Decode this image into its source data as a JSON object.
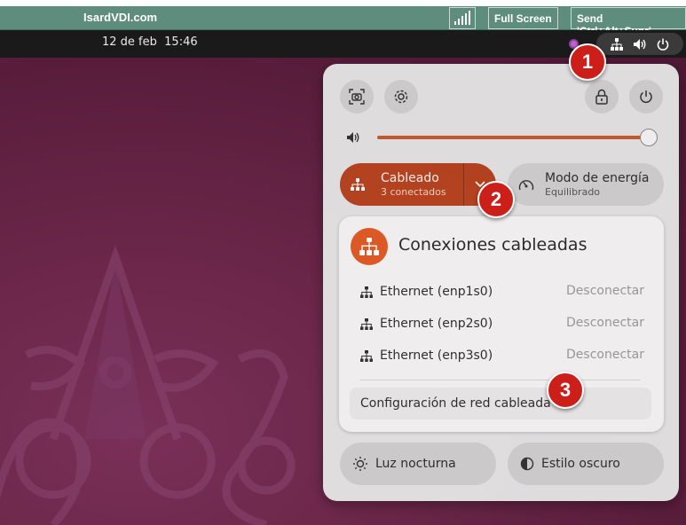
{
  "isard_bar": {
    "logo": "IsardVDI.com",
    "full_screen_label": "Full Screen",
    "send_keys_label": "Send 'Ctrl+Alt+Supr'"
  },
  "top_bar": {
    "date": "12 de feb",
    "time": "15:46"
  },
  "quick_settings": {
    "volume_level_percent": 100,
    "wired": {
      "title": "Cableado",
      "subtitle": "3 conectados"
    },
    "power_mode": {
      "title": "Modo de energía",
      "subtitle": "Equilibrado"
    },
    "night_light_label": "Luz nocturna",
    "dark_style_label": "Estilo oscuro",
    "wired_menu": {
      "title": "Conexiones cableadas",
      "connections": [
        {
          "name": "Ethernet (enp1s0)",
          "action": "Desconectar"
        },
        {
          "name": "Ethernet (enp2s0)",
          "action": "Desconectar"
        },
        {
          "name": "Ethernet (enp3s0)",
          "action": "Desconectar"
        }
      ],
      "settings_label": "Configuración de red cableada"
    }
  },
  "callouts": [
    "1",
    "2",
    "3"
  ],
  "colors": {
    "accent": "#e05a25",
    "wired_active": "#b5441f",
    "isard_bar": "#5e8d7d",
    "callout": "#cc1f1a"
  }
}
